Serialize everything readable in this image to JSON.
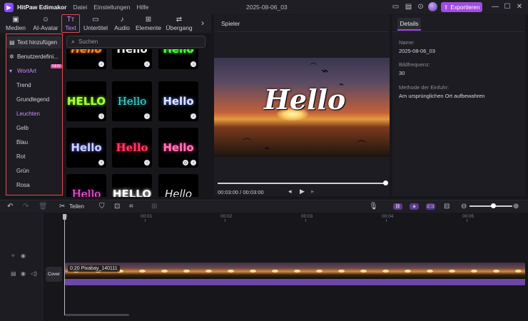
{
  "app": {
    "name": "HitPaw Edimakor",
    "menus": [
      "Datei",
      "Einstellungen",
      "Hilfe"
    ],
    "document_title": "2025-08-06_03",
    "export_label": "Exportieren"
  },
  "toolbar": {
    "tabs": [
      {
        "label": "Medien",
        "icon": "folder-icon"
      },
      {
        "label": "AI-Avatar",
        "icon": "ai-avatar-icon"
      },
      {
        "label": "Text",
        "icon": "text-icon"
      },
      {
        "label": "Untertitel",
        "icon": "subtitle-icon"
      },
      {
        "label": "Audio",
        "icon": "music-note-icon"
      },
      {
        "label": "Elemente",
        "icon": "elements-icon"
      },
      {
        "label": "Übergang",
        "icon": "transition-icon"
      }
    ]
  },
  "sidebar": {
    "items": [
      {
        "label": "Text hinzufügen"
      },
      {
        "label": "Benutzerdefini..."
      },
      {
        "label": "WortArt"
      }
    ],
    "badge": "NEW",
    "subitems": [
      "Trend",
      "Grundlegend",
      "Leuchten",
      "Gelb",
      "Blau",
      "Rot",
      "Grün",
      "Rosa"
    ],
    "active_subitem": "Leuchten"
  },
  "search": {
    "placeholder": "Suchen"
  },
  "templates": [
    {
      "word": "Hello",
      "color": "#f28c28"
    },
    {
      "word": "Hello",
      "color": "#f4f4f4"
    },
    {
      "word": "Hello",
      "color": "#4cff3c"
    },
    {
      "word": "HELLO",
      "color": "#a8ff3c"
    },
    {
      "word": "Hello",
      "color": "#4fd8d8"
    },
    {
      "word": "Hello",
      "color": "#dfe6ff"
    },
    {
      "word": "Hello",
      "color": "#c9d4ff"
    },
    {
      "word": "Hello",
      "color": "#ff3c6a"
    },
    {
      "word": "Hello",
      "color": "#ff7ab8"
    },
    {
      "word": "Hello",
      "color": "#ff6ec7"
    },
    {
      "word": "HELLO",
      "color": "#ffffff"
    },
    {
      "word": "Hello",
      "color": "#eaeaea"
    }
  ],
  "player": {
    "title": "Spieler",
    "overlay_text": "Hello",
    "current_time": "00:03:00",
    "total_time": "00:03:00"
  },
  "details": {
    "tab": "Details",
    "name_label": "Name:",
    "name_value": "2025-08-06_03",
    "framerate_label": "Bildfrequenz:",
    "framerate_value": "30",
    "import_label": "Methode der Einfuhr:",
    "import_value": "Am ursprünglichen Ort aufbewahren"
  },
  "timeline": {
    "split_label": "Teilen",
    "ruler": [
      "0",
      "00:01",
      "00:02",
      "00:03",
      "00:04",
      "00:05"
    ],
    "cover_label": "Cover",
    "clip_label": "0:20  Pixabay_140111"
  },
  "colors": {
    "accent": "#a04ce0",
    "highlight_border": "#e24c4c",
    "active_text": "#c98cff"
  }
}
